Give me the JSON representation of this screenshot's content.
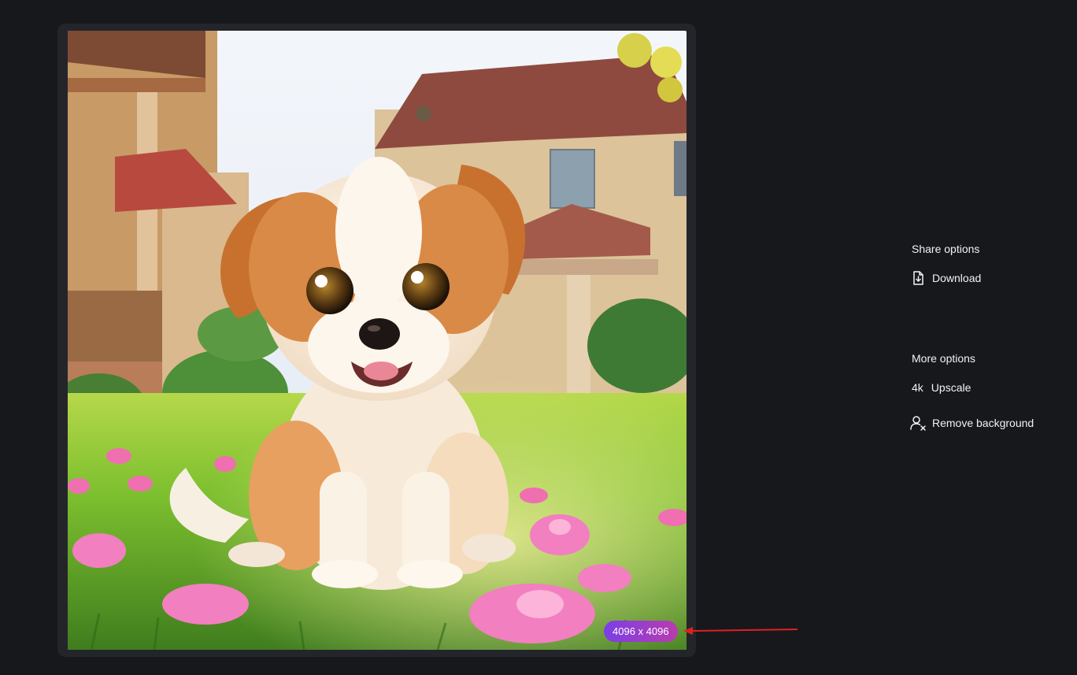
{
  "image": {
    "resolution": "4096 x 4096",
    "subject_icon": "puppy-photo"
  },
  "share": {
    "title": "Share options",
    "download_label": "Download",
    "download_icon": "download-file-icon"
  },
  "more": {
    "title": "More options",
    "upscale_prefix": "4k",
    "upscale_label": "Upscale",
    "remove_bg_label": "Remove background",
    "remove_bg_icon": "person-remove-icon"
  },
  "colors": {
    "background": "#17181c",
    "frame": "#24252b",
    "badge_start": "#7b3fe6",
    "badge_end": "#b93caf",
    "annotation": "#e02020"
  }
}
